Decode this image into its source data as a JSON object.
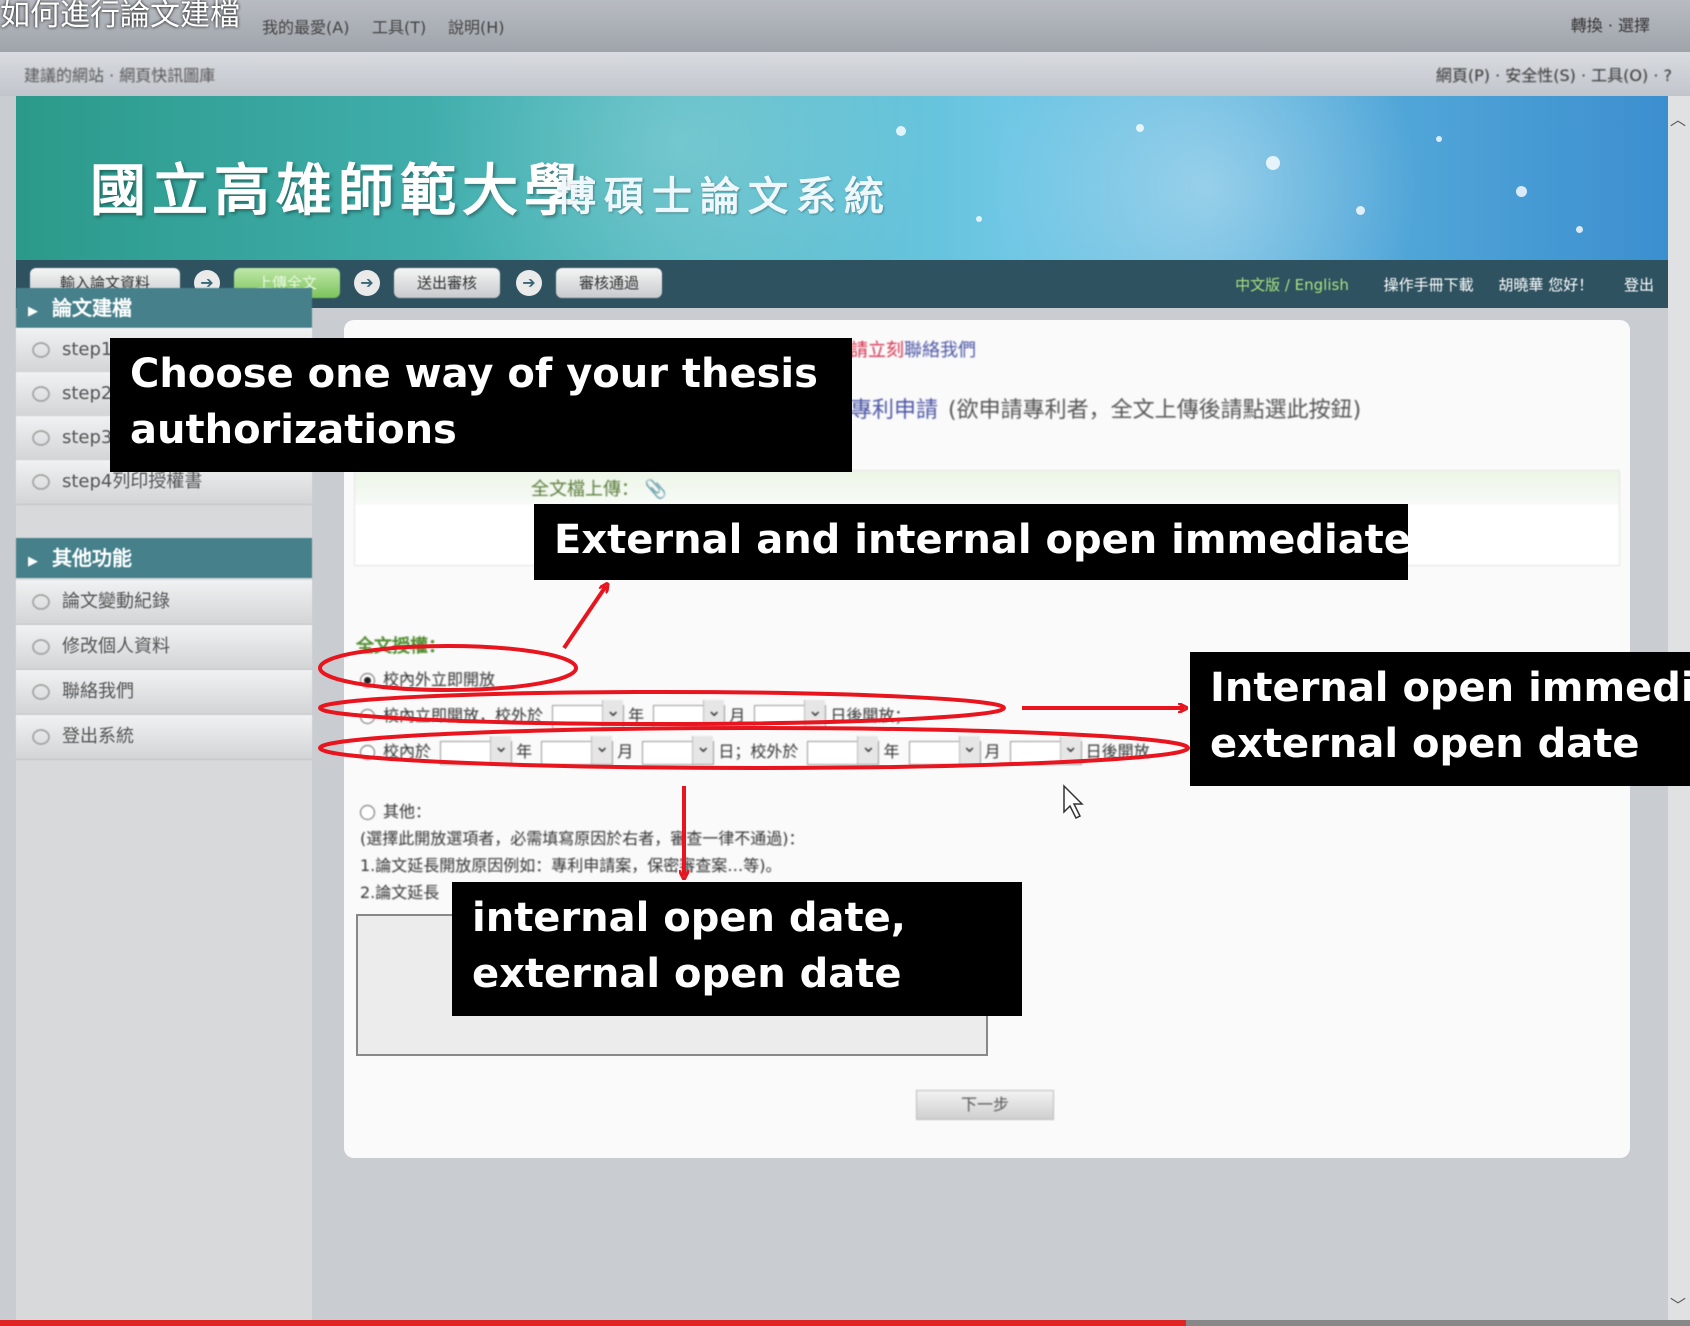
{
  "video_title": "如何進行論文建檔",
  "browser": {
    "menu_items": [
      "我的最愛(A)",
      "工具(T)",
      "說明(H)"
    ],
    "menu_right": "轉換 · 選擇",
    "toolbar_left": "建議的網站 · 網頁快訊圖庫",
    "toolbar_right": "網頁(P) · 安全性(S) · 工具(O) · ?"
  },
  "banner": {
    "university": "國立高雄師範大學",
    "system": "博碩士論文系統"
  },
  "nav": {
    "steps": [
      "輸入論文資料",
      "上傳全文",
      "送出審核",
      "審核通過"
    ],
    "active_step": 1,
    "lang": "中文版 / English",
    "manual": "操作手冊下載",
    "user": "胡曉華 您好！",
    "logout": "登出"
  },
  "sidebar": {
    "section1": "論文建檔",
    "section1_items": [
      "step1",
      "step2",
      "step3",
      "step4列印授權書"
    ],
    "section2": "其他功能",
    "section2_items": [
      "論文變動紀錄",
      "修改個人資料",
      "聯絡我們",
      "登出系統"
    ]
  },
  "main": {
    "contact_prefix": "請立刻",
    "contact_link": "聯絡我們",
    "patent_link": "專利申請",
    "patent_note": "(欲申請專利者，全文上傳後請點選此按鈕)",
    "upload_label": "全文檔上傳：",
    "auth_title": "全文授權：",
    "option1": "校內外立即開放",
    "option2": "校內立即開放，校外於",
    "option2_suffix": "日後開放；",
    "option3_prefix": "校內於",
    "option3_mid": "日；校外於",
    "option3_suffix": "日後開放",
    "unit_year": "年",
    "unit_month": "月",
    "other_label": "其他：",
    "other_line1": "(選擇此開放選項者，必需填寫原因於右者，審查一律不通過)：",
    "other_line2": "1.論文延長開放原因例如：專利申請案，保密審查案…等)。",
    "other_line3": "2.論文延長",
    "next_button": "下一步"
  },
  "annotations": {
    "callout1": "Choose one way of your thesis authorizations",
    "callout2": "External and internal open immediately",
    "callout3_line1": "Internal open immediately,",
    "callout3_line2": "external open date",
    "callout4_line1": "internal open date,",
    "callout4_line2": "external open date",
    "arrow_color": "#e8141e"
  }
}
